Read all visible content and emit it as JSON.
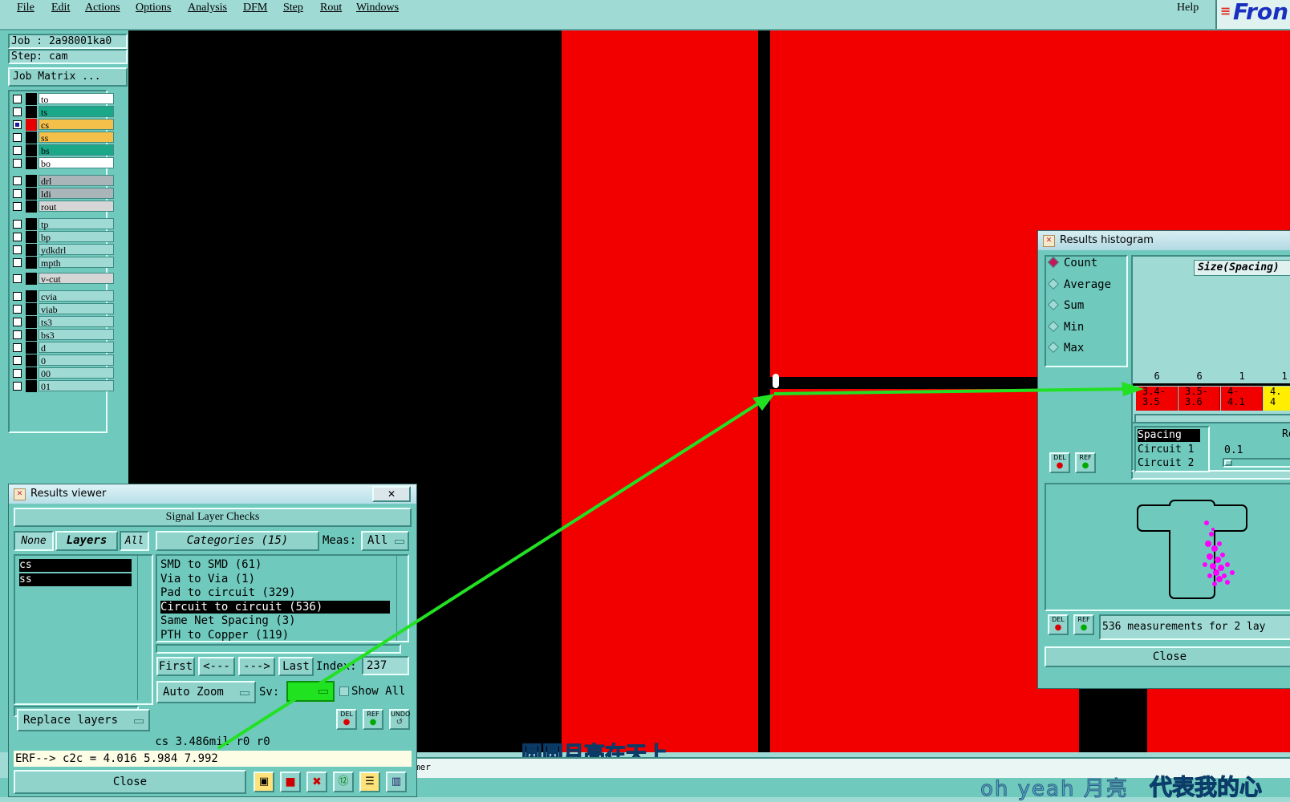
{
  "menu": [
    "File",
    "Edit",
    "Actions",
    "Options",
    "Analysis",
    "DFM",
    "Step",
    "Rout",
    "Windows"
  ],
  "help": "Help",
  "brand": "Fron",
  "job": {
    "job_label": "Job : 2a98001ka0",
    "step_label": "Step: cam",
    "matrix_button": "Job Matrix ..."
  },
  "layers": [
    {
      "name": "to",
      "color": "#ffffff",
      "selected": false
    },
    {
      "name": "ts",
      "color": "#1aa889",
      "selected": false
    },
    {
      "name": "cs",
      "color": "#f5c04a",
      "selected": true
    },
    {
      "name": "ss",
      "color": "#f5c04a",
      "selected": false
    },
    {
      "name": "bs",
      "color": "#1aa889",
      "selected": false
    },
    {
      "name": "bo",
      "color": "#ffffff",
      "selected": false
    },
    {
      "name": "drl",
      "color": "#a9b5b8",
      "selected": false
    },
    {
      "name": "ldi",
      "color": "#a9b5b8",
      "selected": false
    },
    {
      "name": "rout",
      "color": "#d6d6d6",
      "selected": false
    },
    {
      "name": "tp",
      "color": "#9fdad4",
      "selected": false
    },
    {
      "name": "bp",
      "color": "#9fdad4",
      "selected": false
    },
    {
      "name": "ydkdrl",
      "color": "#9fdad4",
      "selected": false
    },
    {
      "name": "mpth",
      "color": "#9fdad4",
      "selected": false
    },
    {
      "name": "v-cut",
      "color": "#d6d6d6",
      "selected": false
    },
    {
      "name": "cvia",
      "color": "#9fdad4",
      "selected": false
    },
    {
      "name": "viab",
      "color": "#9fdad4",
      "selected": false
    },
    {
      "name": "ts3",
      "color": "#9fdad4",
      "selected": false
    },
    {
      "name": "bs3",
      "color": "#9fdad4",
      "selected": false
    },
    {
      "name": "d",
      "color": "#9fdad4",
      "selected": false
    },
    {
      "name": "0",
      "color": "#9fdad4",
      "selected": false
    },
    {
      "name": "00",
      "color": "#9fdad4",
      "selected": false
    },
    {
      "name": "01",
      "color": "#9fdad4",
      "selected": false
    }
  ],
  "results_viewer": {
    "title": "Results viewer",
    "close_x": "✕",
    "header": "Signal Layer Checks",
    "none_btn": "None",
    "layers_btn": "Layers",
    "all_btn": "All",
    "categories_btn": "Categories (15)",
    "meas_label": "Meas:",
    "meas_value": "All",
    "layer_list": [
      "cs",
      "ss"
    ],
    "categories": [
      "SMD to SMD (61)",
      "Via to Via (1)",
      "Pad to circuit (329)",
      "Circuit to circuit (536)",
      "Same Net Spacing (3)",
      "PTH to Copper (119)"
    ],
    "selected_category_index": 3,
    "first_btn": "First",
    "prev_btn": "<---",
    "next_btn": "--->",
    "last_btn": "Last",
    "index_label": "Index:",
    "index_value": "237",
    "auto_zoom": "Auto Zoom",
    "sv_label": "Sv:",
    "show_all": "Show All",
    "replace_layers": "Replace layers",
    "del": "DEL",
    "ref": "REF",
    "undo": "UNDO",
    "status_line": "cs 3.486mil  r0  r0",
    "erf_line": "ERF--> c2c = 4.016 5.984 7.992",
    "close_btn": "Close"
  },
  "histogram": {
    "title": "Results histogram",
    "modes": [
      "Count",
      "Average",
      "Sum",
      "Min",
      "Max"
    ],
    "selected_mode": "Count",
    "axis_label": "Size(Spacing)",
    "bins": [
      {
        "count": "6",
        "range": "3.4-\n3.5",
        "color": "#f20000"
      },
      {
        "count": "6",
        "range": "3.5-\n3.6",
        "color": "#f20000"
      },
      {
        "count": "1",
        "range": "4-\n4.1",
        "color": "#f20000"
      },
      {
        "count": "1",
        "range": "4.\n4",
        "color": "#ffee00"
      }
    ],
    "param_list": [
      "Spacing",
      "Circuit 1",
      "Circuit 2"
    ],
    "re_label": "Re",
    "re_value": "0.1",
    "summary": "536 measurements for 2 lay",
    "close_btn": "Close",
    "del": "DEL",
    "ref": "REF"
  },
  "cmdline_hint": "mer",
  "overlay": {
    "caption1": "圆圆月亮在天上",
    "caption2_a": "oh yeah 月亮",
    "caption2_b": "代表我的心"
  }
}
